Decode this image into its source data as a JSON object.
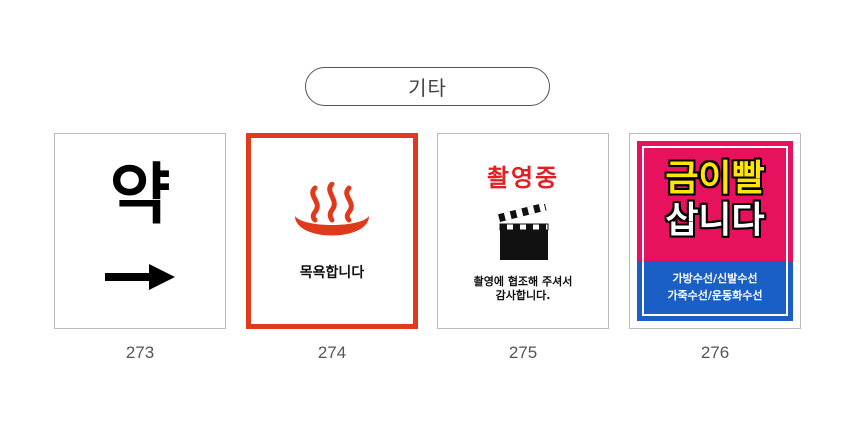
{
  "category": {
    "label": "기타"
  },
  "signs": [
    {
      "number": "273",
      "text": "약",
      "icon": "right-arrow-icon"
    },
    {
      "number": "274",
      "text": "목욕합니다",
      "icon": "hot-spring-icon",
      "accent": "#e03a1c"
    },
    {
      "number": "275",
      "title": "촬영중",
      "line1": "촬영에 협조해 주셔서",
      "line2": "감사합니다.",
      "icon": "clapperboard-icon",
      "accent": "#e31e24"
    },
    {
      "number": "276",
      "line1": "금이빨",
      "line2": "삽니다",
      "small1": "가방수선/신발수선",
      "small2": "가죽수선/운동화수선",
      "bg_top": "#e8115e",
      "bg_bottom": "#1a5fc6",
      "highlight": "#ffe500"
    }
  ]
}
